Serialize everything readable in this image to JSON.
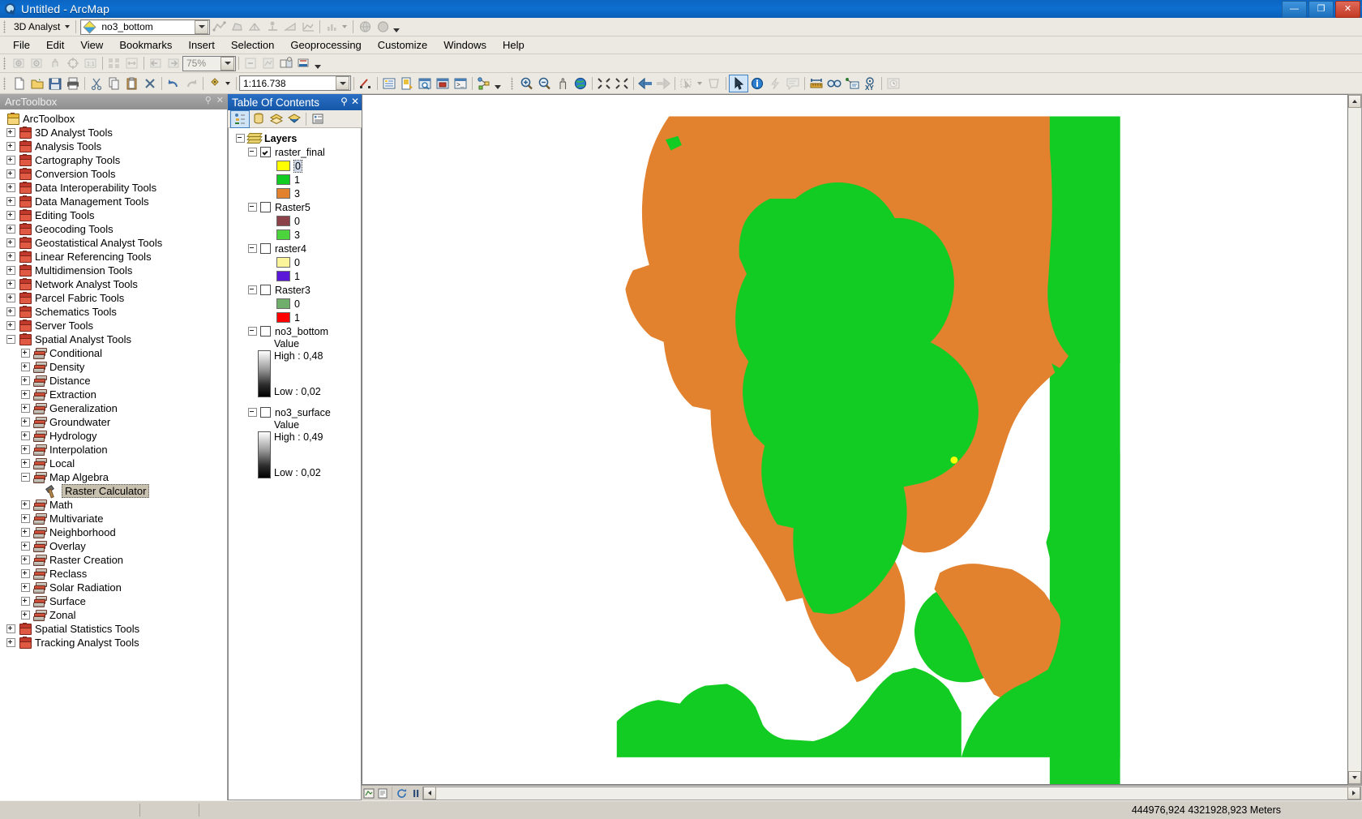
{
  "window": {
    "title": "Untitled - ArcMap",
    "icon": "arcmap-magnifier-icon",
    "minimize": "—",
    "maximize": "❐",
    "close": "✕"
  },
  "analyst_toolbar": {
    "menu_label": "3D Analyst",
    "layer_value": "no3_bottom",
    "icons": [
      "interpolate-line-icon",
      "interpolate-polygon-icon",
      "create-tin-icon",
      "add-features-icon",
      "line-of-sight-icon",
      "profile-graph-icon",
      "histogram-icon",
      "scene-globe-icon",
      "arcglobe-icon"
    ]
  },
  "menubar": {
    "items": [
      "File",
      "Edit",
      "View",
      "Bookmarks",
      "Insert",
      "Selection",
      "Geoprocessing",
      "Customize",
      "Windows",
      "Help"
    ]
  },
  "editor_toolbar": {
    "zoom_value": "75%",
    "icons": [
      "zoom-in-icon",
      "zoom-out-icon",
      "pan-icon",
      "full-extent-icon",
      "one-to-one-icon",
      "zoom-whole-page-icon",
      "zoom-page-width-icon",
      "previous-extent-icon",
      "next-extent-icon",
      "toggle-draft-icon",
      "refresh-icon",
      "change-layout-icon",
      "data-driven-pages-icon"
    ]
  },
  "standard_toolbar": {
    "scale_value": "1:116.738",
    "icons": [
      "new-document-icon",
      "open-folder-icon",
      "save-icon",
      "print-icon",
      "cut-icon",
      "copy-icon",
      "paste-icon",
      "delete-icon",
      "undo-icon",
      "redo-icon",
      "add-data-icon",
      "add-data-dropdown-icon",
      "editor-toolbar-icon",
      "table-of-contents-icon",
      "catalog-icon",
      "search-icon",
      "arctoolbox-icon",
      "python-window-icon",
      "model-builder-icon"
    ]
  },
  "tools_toolbar": {
    "icons": [
      "zoom-in-icon",
      "zoom-out-icon",
      "pan-icon",
      "full-extent-globe-icon",
      "fixed-zoom-in-icon",
      "fixed-zoom-out-icon",
      "back-extent-icon",
      "forward-extent-icon",
      "select-features-icon",
      "select-dropdown-icon",
      "clear-selection-icon",
      "select-elements-icon",
      "identify-icon",
      "hyperlink-icon",
      "html-popup-icon",
      "measure-icon",
      "find-icon",
      "find-route-icon",
      "go-to-xy-icon",
      "time-slider-icon"
    ]
  },
  "arctoolbox": {
    "panel_title": "ArcToolbox",
    "pin_icon": "pin-icon",
    "close_icon": "close-icon",
    "root": "ArcToolbox",
    "toolboxes": [
      {
        "label": "3D Analyst Tools",
        "expanded": false
      },
      {
        "label": "Analysis Tools",
        "expanded": false
      },
      {
        "label": "Cartography Tools",
        "expanded": false
      },
      {
        "label": "Conversion Tools",
        "expanded": false
      },
      {
        "label": "Data Interoperability Tools",
        "expanded": false
      },
      {
        "label": "Data Management Tools",
        "expanded": false
      },
      {
        "label": "Editing Tools",
        "expanded": false
      },
      {
        "label": "Geocoding Tools",
        "expanded": false
      },
      {
        "label": "Geostatistical Analyst Tools",
        "expanded": false
      },
      {
        "label": "Linear Referencing Tools",
        "expanded": false
      },
      {
        "label": "Multidimension Tools",
        "expanded": false
      },
      {
        "label": "Network Analyst Tools",
        "expanded": false
      },
      {
        "label": "Parcel Fabric Tools",
        "expanded": false
      },
      {
        "label": "Schematics Tools",
        "expanded": false
      },
      {
        "label": "Server Tools",
        "expanded": false
      },
      {
        "label": "Spatial Analyst Tools",
        "expanded": true
      },
      {
        "label": "Spatial Statistics Tools",
        "expanded": false
      },
      {
        "label": "Tracking Analyst Tools",
        "expanded": false
      }
    ],
    "spatial_analyst_toolsets": [
      {
        "label": "Conditional",
        "expanded": false
      },
      {
        "label": "Density",
        "expanded": false
      },
      {
        "label": "Distance",
        "expanded": false
      },
      {
        "label": "Extraction",
        "expanded": false
      },
      {
        "label": "Generalization",
        "expanded": false
      },
      {
        "label": "Groundwater",
        "expanded": false
      },
      {
        "label": "Hydrology",
        "expanded": false
      },
      {
        "label": "Interpolation",
        "expanded": false
      },
      {
        "label": "Local",
        "expanded": false
      },
      {
        "label": "Map Algebra",
        "expanded": true
      },
      {
        "label": "Math",
        "expanded": false
      },
      {
        "label": "Multivariate",
        "expanded": false
      },
      {
        "label": "Neighborhood",
        "expanded": false
      },
      {
        "label": "Overlay",
        "expanded": false
      },
      {
        "label": "Raster Creation",
        "expanded": false
      },
      {
        "label": "Reclass",
        "expanded": false
      },
      {
        "label": "Solar Radiation",
        "expanded": false
      },
      {
        "label": "Surface",
        "expanded": false
      },
      {
        "label": "Zonal",
        "expanded": false
      }
    ],
    "map_algebra_tools": [
      {
        "label": "Raster Calculator",
        "selected": true
      }
    ]
  },
  "toc": {
    "panel_title": "Table Of Contents",
    "pin_icon": "pin-icon",
    "close_icon": "close-icon",
    "toolbar_icons": [
      "list-by-drawing-order-icon",
      "list-by-source-icon",
      "list-by-visibility-icon",
      "list-by-selection-icon",
      "options-icon"
    ],
    "root": "Layers",
    "layers": [
      {
        "name": "raster_final",
        "checked": true,
        "type": "classified",
        "classes": [
          {
            "label": "0",
            "color": "#FFFF00",
            "selected": true
          },
          {
            "label": "1",
            "color": "#13CC23"
          },
          {
            "label": "3",
            "color": "#E2812E"
          }
        ]
      },
      {
        "name": "Raster5",
        "checked": false,
        "type": "classified",
        "classes": [
          {
            "label": "0",
            "color": "#8B4349"
          },
          {
            "label": "3",
            "color": "#4CD43C"
          }
        ]
      },
      {
        "name": "raster4",
        "checked": false,
        "type": "classified",
        "classes": [
          {
            "label": "0",
            "color": "#FBF49A"
          },
          {
            "label": "1",
            "color": "#5A17D8"
          }
        ]
      },
      {
        "name": "Raster3",
        "checked": false,
        "type": "classified",
        "classes": [
          {
            "label": "0",
            "color": "#6FAE6B"
          },
          {
            "label": "1",
            "color": "#FF0000"
          }
        ]
      },
      {
        "name": "no3_bottom",
        "checked": false,
        "type": "stretched",
        "value_label": "Value",
        "high": "High : 0,48",
        "low": "Low : 0,02"
      },
      {
        "name": "no3_surface",
        "checked": false,
        "type": "stretched",
        "value_label": "Value",
        "high": "High : 0,49",
        "low": "Low : 0,02"
      }
    ]
  },
  "map": {
    "data_view_icon": "data-view-icon",
    "layout-view_icon": "layout-view-icon",
    "refresh_icon": "refresh-view-icon",
    "pause_icon": "pause-drawing-icon",
    "point_marker_color": "#FFFF00",
    "raster_colors": {
      "class_green": "#13CC23",
      "class_orange": "#E2812E",
      "nodata": "#FFFFFF"
    }
  },
  "statusbar": {
    "coordinates": "444976,924  4321928,923 Meters"
  }
}
